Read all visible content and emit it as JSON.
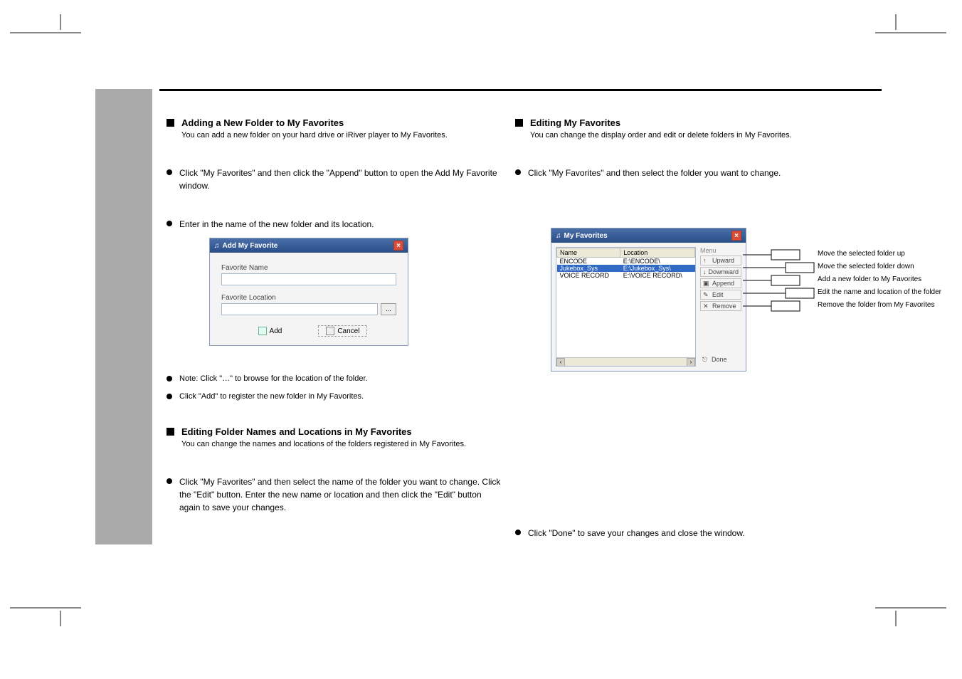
{
  "left": {
    "h1": "Adding a New Folder to My Favorites",
    "h1_sub": "You can add a new folder on your hard drive or iRiver player to My Favorites.",
    "b1": "Click \"My Favorites\" and then click the \"Append\" button to open the Add My Favorite window.",
    "b2": "Enter in the name of the new folder and its location.",
    "note1": "Note: Click \"…\" to browse for the location of the folder.",
    "note2": "Click \"Add\" to register the new folder in My Favorites.",
    "h2": "Editing Folder Names and Locations in My Favorites",
    "h2_sub": "You can change the names and locations of the folders registered in My Favorites.",
    "b3": "Click \"My Favorites\" and then select the name of the folder you want to change. Click the \"Edit\" button. Enter the new name or location and then click the \"Edit\" button again to save your changes."
  },
  "right": {
    "h1": "Editing My Favorites",
    "h1_sub": "You can change the display order and edit or delete folders in My Favorites.",
    "b1": "Click \"My Favorites\" and then select the folder you want to change.",
    "b2": "Click \"Done\" to save your changes and close the window."
  },
  "callouts": {
    "c1": "Move the selected folder up",
    "c2": "Move the selected folder down",
    "c3": "Add a new folder to My Favorites",
    "c4": "Edit the name and location of the folder",
    "c5": "Remove the folder from My Favorites"
  },
  "dlg_add": {
    "title": "Add My Favorite",
    "lbl_name": "Favorite Name",
    "lbl_loc": "Favorite Location",
    "browse": "...",
    "add": "Add",
    "cancel": "Cancel"
  },
  "dlg_fav": {
    "title": "My Favorites",
    "col_name": "Name",
    "col_loc": "Location",
    "rows": [
      {
        "name": "ENCODE",
        "loc": "E:\\ENCODE\\"
      },
      {
        "name": "Jukebox_Sys",
        "loc": "E:\\Jukebox_Sys\\"
      },
      {
        "name": "VOICE RECORD",
        "loc": "E:\\VOICE RECORD\\"
      }
    ],
    "menu_label": "Menu",
    "m_up": "Upward",
    "m_down": "Downward",
    "m_append": "Append",
    "m_edit": "Edit",
    "m_remove": "Remove",
    "m_done": "Done"
  }
}
